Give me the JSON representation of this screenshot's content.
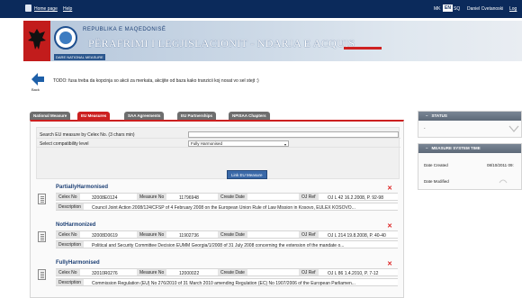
{
  "topbar": {
    "home_link": "Home page",
    "help_link": "Help",
    "lang_mk": "MK",
    "lang_en": "EN",
    "lang_sq": "SQ",
    "user_name": "Daniel Cvetanoski",
    "logout": "Log"
  },
  "banner": {
    "subtitle": "REPUBLIKA E MAQEDONISË",
    "title": "PËRAFRIMI I LEGJISLACIONIT - NDARJA E ACQUIS",
    "org": "DARE NATIONAL MEASURE"
  },
  "back_label": "Back",
  "todo_text": "TODO: fusa treba da kopcinja so akcii za merkata, akcijite od baza kako tranzicii koj nosat vo sel stejt :)",
  "tabs": [
    {
      "label": "National Measure"
    },
    {
      "label": "EU Measures"
    },
    {
      "label": "SAA Agreements"
    },
    {
      "label": "EU Partnerships"
    },
    {
      "label": "NPISAA Chapters"
    }
  ],
  "search": {
    "celex_label": "Search EU measure by Celex No. (3 chars min)",
    "celex_value": "",
    "compat_label": "Select compatibility level",
    "compat_value": "Fully Harmonised",
    "button": "Link EU Measure"
  },
  "results": [
    {
      "title": "PartiallyHarmonised",
      "celex_label": "Celex No",
      "celex": "32008E0124",
      "measure_label": "Measure No",
      "measure": "11796948",
      "date_label": "Create Date",
      "date": "",
      "ojref_label": "OJ Ref",
      "ojref": "OJ L 42 16.2.2008, P. 92-98",
      "desc_label": "Description",
      "desc": "Council Joint Action 2008/124/CFSP of 4 February 2008 on the European Union Rule of Law Mission in Kosovo, EULEX KOSOVO..."
    },
    {
      "title": "NotHarmonized",
      "celex_label": "Celex No",
      "celex": "32008D0619",
      "measure_label": "Measure No",
      "measure": "11902736",
      "date_label": "Create Date",
      "date": "",
      "ojref_label": "OJ Ref",
      "ojref": "OJ L 214 19.8.2008, P. 40-40",
      "desc_label": "Description",
      "desc": "Political and Security Committee Decision EUMM Georgia/1/2008 of 31 July 2008 concerning the extension of the mandate o..."
    },
    {
      "title": "FullyHarmonised",
      "celex_label": "Celex No",
      "celex": "32010R0276",
      "measure_label": "Measure No",
      "measure": "12000022",
      "date_label": "Create Date",
      "date": "",
      "ojref_label": "OJ Ref",
      "ojref": "OJ L 86 1.4.2010, P. 7-12",
      "desc_label": "Description",
      "desc": "Commission Regulation (EU) No 276/2010 of 31 March 2010 amending Regulation (EC) No 1907/2006 of the European Parliamen..."
    }
  ],
  "sidebar": {
    "status_title": "STATUS",
    "status_value": "-",
    "time_title": "MEASURE SYSTEM TIME",
    "created_label": "Date Created",
    "created_value": "08/10/2011 09:",
    "modified_label": "Date Modified"
  },
  "colors": {
    "accent_red": "#cc2020",
    "navy": "#0b2a5b",
    "link_blue": "#1c3f74"
  }
}
